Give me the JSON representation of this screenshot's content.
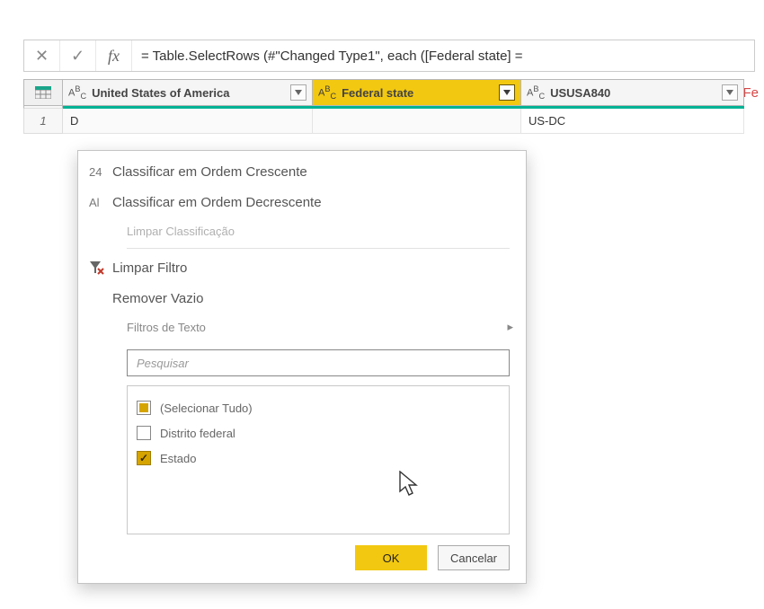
{
  "formula_bar": {
    "text": "= Table.SelectRows (#\"Changed Type1\", each ([Federal state] =",
    "hint_suffix": "\"Fe"
  },
  "columns": {
    "a": {
      "type": "ABC",
      "label": "United States of America"
    },
    "b": {
      "type": "ABC",
      "label": "Federal state"
    },
    "c": {
      "type": "ABC",
      "label": "USUSA840"
    }
  },
  "rows": [
    {
      "n": "1",
      "a": "D",
      "b": "",
      "c": "US-DC"
    }
  ],
  "menu": {
    "sort_asc": {
      "icon_text": "24",
      "label": "Classificar em Ordem Crescente"
    },
    "sort_desc": {
      "icon_text": "Al",
      "label": "Classificar em Ordem Decrescente"
    },
    "clear_sort": "Limpar Classificação",
    "clear_filter": "Limpar Filtro",
    "remove_empty": "Remover Vazio",
    "text_filters": "Filtros de Texto",
    "search_placeholder": "Pesquisar",
    "items": [
      {
        "label": "(Selecionar Tudo)",
        "state": "partial"
      },
      {
        "label": "Distrito federal",
        "state": "unchecked"
      },
      {
        "label": "Estado",
        "state": "checked"
      }
    ],
    "ok": "OK",
    "cancel": "Cancelar"
  }
}
